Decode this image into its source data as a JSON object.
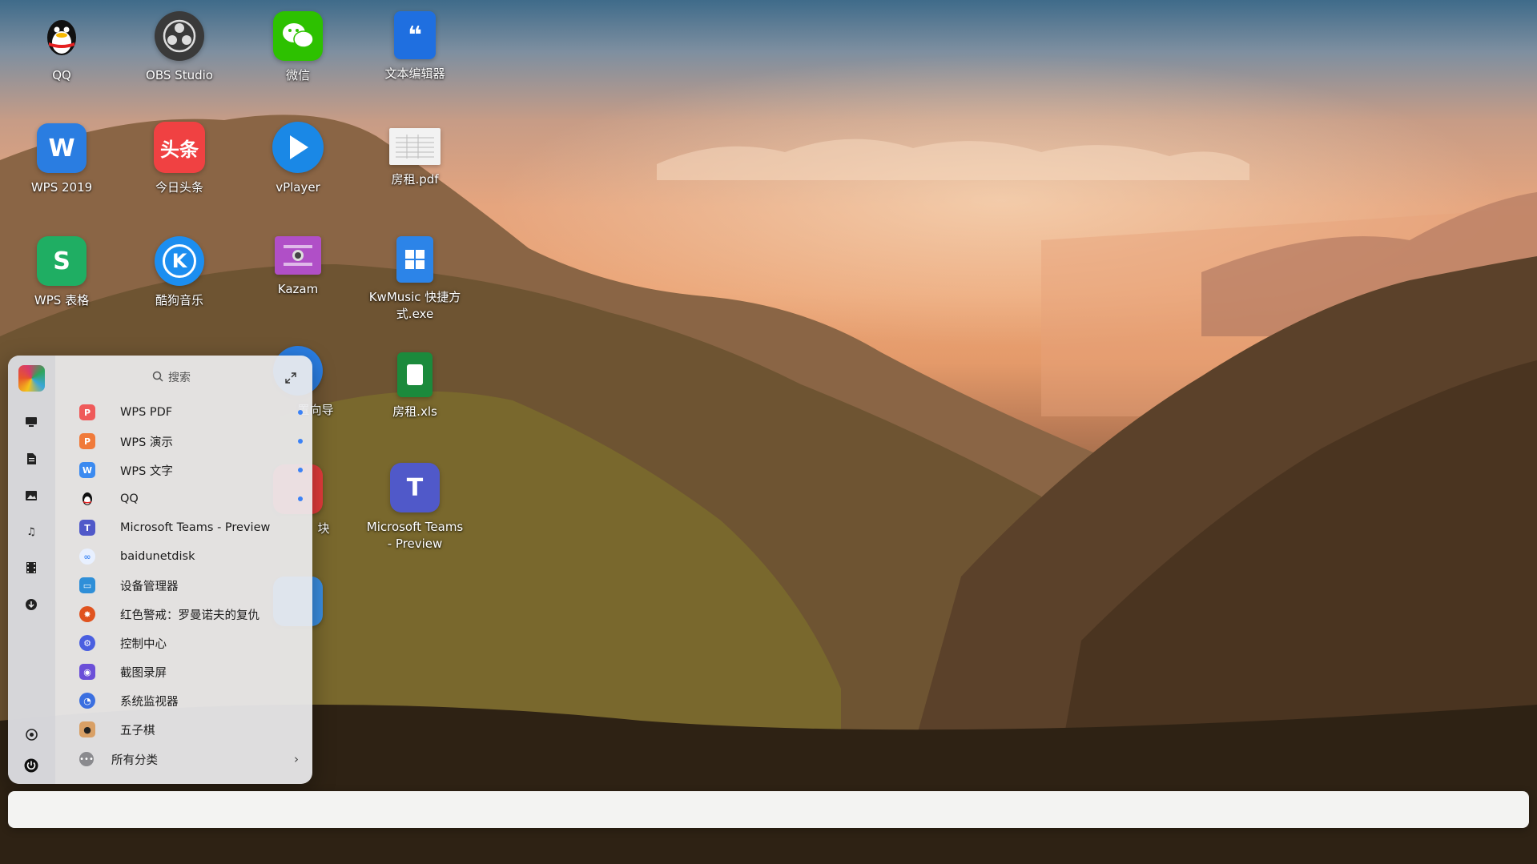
{
  "desktop": {
    "icons": [
      {
        "label": "QQ",
        "icon": "qq-penguin-icon",
        "color": "#111111"
      },
      {
        "label": "OBS Studio",
        "icon": "obs-icon",
        "color": "#3a3a3a"
      },
      {
        "label": "微信",
        "icon": "wechat-icon",
        "color": "#2dc100"
      },
      {
        "label": "文本编辑器",
        "icon": "text-editor-icon",
        "color": "#1f6fe0"
      },
      {
        "label": "WPS 2019",
        "icon": "wps-icon",
        "color": "#2a7de1"
      },
      {
        "label": "今日头条",
        "icon": "toutiao-icon",
        "color": "#f04142"
      },
      {
        "label": "vPlayer",
        "icon": "play-icon",
        "color": "#1a88e6"
      },
      {
        "label": "房租.pdf",
        "icon": "pdf-file-icon",
        "color": "#f2f2f2"
      },
      {
        "label": "WPS 表格",
        "icon": "wps-spreadsheet-icon",
        "color": "#1fae63"
      },
      {
        "label": "酷狗音乐",
        "icon": "kugou-icon",
        "color": "#1c8ef0"
      },
      {
        "label": "Kazam",
        "icon": "kazam-icon",
        "color": "#b04fc7"
      },
      {
        "label": "KwMusic 快捷方式.exe",
        "icon": "kwmusic-shortcut-icon",
        "color": "#2c84e8"
      },
      {
        "label": "置向导",
        "icon": "setup-wizard-icon",
        "color": "#2a7de1"
      },
      {
        "label": "房租.xls",
        "icon": "xls-file-icon",
        "color": "#1b8a3c"
      },
      {
        "label": "块",
        "icon": "app-icon",
        "color": "#e23b3b"
      },
      {
        "label": "Microsoft Teams - Preview",
        "icon": "teams-icon",
        "color": "#5059c9"
      },
      {
        "label": "",
        "icon": "app-icon",
        "color": "#3a8de0"
      }
    ]
  },
  "start_menu": {
    "search_placeholder": "搜索",
    "apps": [
      {
        "name": "WPS PDF",
        "icon": "wps-pdf-icon",
        "color": "#ef5a5a",
        "glyph": "P",
        "new": true
      },
      {
        "name": "WPS 演示",
        "icon": "wps-presentation-icon",
        "color": "#f07a3a",
        "glyph": "P",
        "new": true
      },
      {
        "name": "WPS 文字",
        "icon": "wps-writer-icon",
        "color": "#3b8af0",
        "glyph": "W",
        "new": true
      },
      {
        "name": "QQ",
        "icon": "qq-penguin-icon",
        "color": "#111111",
        "glyph": "Q",
        "new": true
      },
      {
        "name": "Microsoft Teams - Preview",
        "icon": "teams-icon",
        "color": "#5059c9",
        "glyph": "T",
        "new": false
      },
      {
        "name": "baidunetdisk",
        "icon": "baidu-netdisk-icon",
        "color": "#4a8ef5",
        "glyph": "∞",
        "new": false
      },
      {
        "name": "设备管理器",
        "icon": "device-manager-icon",
        "color": "#2f8fd8",
        "glyph": "▭",
        "new": false
      },
      {
        "name": "红色警戒：罗曼诺夫的复仇",
        "icon": "red-alert-icon",
        "color": "#e0531f",
        "glyph": "✸",
        "new": false
      },
      {
        "name": "控制中心",
        "icon": "control-center-icon",
        "color": "#4a5fe0",
        "glyph": "⚙",
        "new": false
      },
      {
        "name": "截图录屏",
        "icon": "screenshot-icon",
        "color": "#6b4fd8",
        "glyph": "◉",
        "new": false
      },
      {
        "name": "系统监视器",
        "icon": "system-monitor-icon",
        "color": "#3b6fe0",
        "glyph": "◔",
        "new": false
      },
      {
        "name": "五子棋",
        "icon": "gomoku-icon",
        "color": "#d9a066",
        "glyph": "●",
        "new": false
      }
    ],
    "all_categories": "所有分类",
    "sidebar": [
      "computer-icon",
      "document-icon",
      "picture-icon",
      "music-icon",
      "video-icon",
      "download-icon",
      "settings-icon",
      "power-icon"
    ]
  },
  "taskbar": {}
}
